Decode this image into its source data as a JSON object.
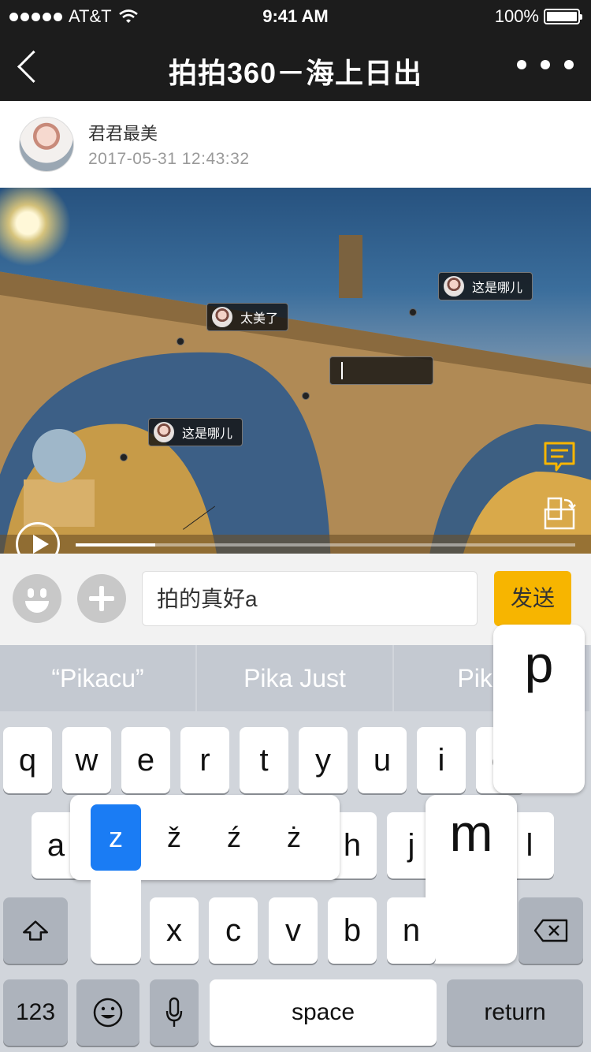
{
  "status_bar": {
    "carrier": "AT&T",
    "time": "9:41 AM",
    "battery": "100%"
  },
  "nav": {
    "title": "拍拍360－海上日出"
  },
  "post": {
    "author": "君君最美",
    "datetime": "2017-05-31   12:43:32"
  },
  "tags": [
    {
      "text": "太美了"
    },
    {
      "text": "这是哪儿"
    },
    {
      "text": "这是哪儿"
    }
  ],
  "video": {
    "progress": 0.16
  },
  "input": {
    "value": "拍的真好a",
    "send_label": "发送"
  },
  "keyboard": {
    "suggestions": [
      "“Pikacu”",
      "Pika Just",
      "Pika J"
    ],
    "row1": [
      "q",
      "w",
      "e",
      "r",
      "t",
      "y",
      "u",
      "i",
      "o"
    ],
    "row2": [
      "a",
      "h",
      "j",
      "l"
    ],
    "row3": [
      "x",
      "c",
      "v",
      "b",
      "n"
    ],
    "z_variants": [
      "z",
      "ž",
      "ź",
      "ż"
    ],
    "popup_p": "p",
    "popup_m": "m",
    "num_label": "123",
    "space_label": "space",
    "return_label": "return"
  },
  "colors": {
    "accent": "#f7b500",
    "selection": "#1a7cf4",
    "navbar": "#1c1c1c"
  }
}
